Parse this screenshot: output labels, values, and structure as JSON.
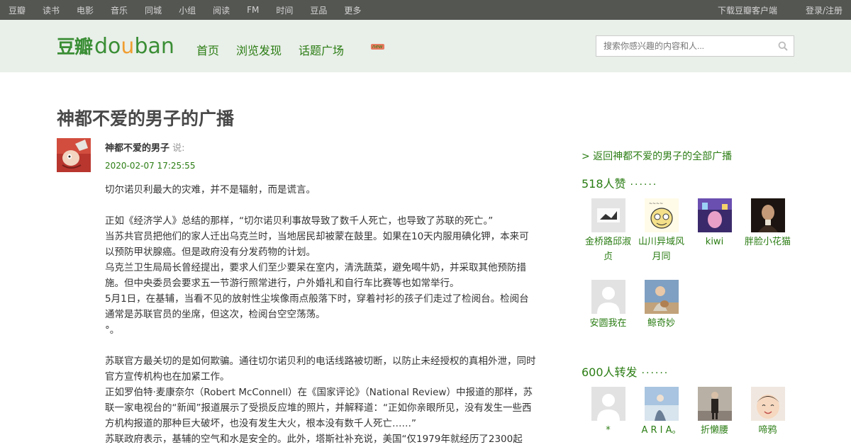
{
  "topnav": {
    "left": [
      "豆瓣",
      "读书",
      "电影",
      "音乐",
      "同城",
      "小组",
      "阅读",
      "FM",
      "时间",
      "豆品",
      "更多"
    ],
    "right": [
      "下载豆瓣客户端",
      "登录/注册"
    ]
  },
  "header": {
    "logo_cn": "豆瓣",
    "logo_en": [
      "do",
      "u",
      "ban"
    ],
    "nav": [
      "首页",
      "浏览发现",
      "话题广场"
    ],
    "new_badge": "new",
    "search_placeholder": "搜索你感兴趣的内容和人..."
  },
  "page": {
    "title": "神都不爱的男子的广播"
  },
  "post": {
    "author": "神都不爱的男子",
    "says": "说:",
    "time": "2020-02-07 17:25:55",
    "paragraphs": [
      "切尔诺贝利最大的灾难，并不是辐射，而是谎言。",
      "",
      "正如《经济学人》总结的那样，“切尔诺贝利事故导致了数千人死亡，也导致了苏联的死亡。”",
      "当苏共官员把他们的家人迁出乌克兰时，当地居民却被蒙在鼓里。如果在10天内服用碘化钾，本来可以预防甲状腺癌。但是政府没有分发药物的计划。",
      "乌克兰卫生局局长曾经提出，要求人们至少要呆在室内，清洗蔬菜，避免喝牛奶，并采取其他预防措施。但中央委员会要求五一节游行照常进行，户外婚礼和自行车比赛等也如常举行。",
      "5月1日，在基辅，当看不见的放射性尘埃像雨点般落下时，穿着衬衫的孩子们走过了检阅台。检阅台通常是苏联官员的坐席，但这次，检阅台空空荡荡。",
      "°。",
      "",
      "苏联官方最关切的是如何欺骗。通往切尔诺贝利的电话线路被切断，以防止未经授权的真相外泄，同时官方宣传机构也在加紧工作。",
      "正如罗伯特·麦康奈尔（Robert McConnell）在《国家评论》（National Review）中报道的那样，苏联一家电视台的“新闻”报道展示了受损反应堆的照片，并解释道：“正如你亲眼所见，没有发生一些西方机构报道的那种巨大破坏，也没有发生大火，根本没有数千人死亡……”",
      "苏联政府表示，基辅的空气和水是安全的。此外，塔斯社补充说，美国“仅1979年就经历了2300起"
    ]
  },
  "sidebar": {
    "back_link": "> 返回神都不爱的男子的全部广播",
    "likes": {
      "title": "518人赞",
      "dots": "······",
      "users": [
        "金桥路邱淑贞",
        "山川异域风月同",
        "kiwi",
        "胖脸小花猫",
        "安圆我在",
        "鲸奇妙"
      ]
    },
    "reshares": {
      "title": "600人转发",
      "dots": "······",
      "users": [
        "*",
        "A R I A。",
        "折懒腰",
        "啼鸦"
      ]
    }
  },
  "colors": {
    "accent_green": "#2b7d14",
    "logo_orange": "#f09e32",
    "topnav_bg": "#545652",
    "header_bg": "#e9efe9"
  }
}
